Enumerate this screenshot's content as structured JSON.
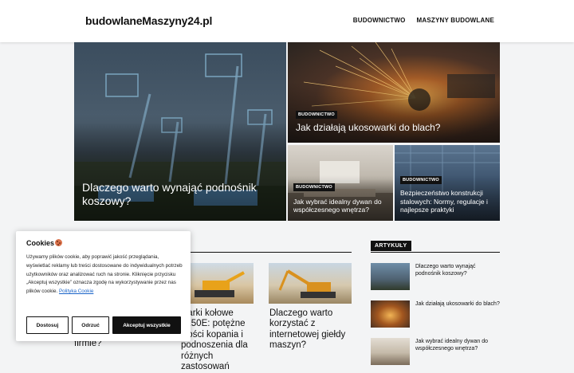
{
  "header": {
    "logo": "budowlaneMaszyny24.pl",
    "nav": [
      "BUDOWNICTWO",
      "MASZYNY BUDOWLANE"
    ]
  },
  "featured": [
    {
      "title": "Dlaczego warto wynająć podnośnik koszowy?",
      "tag": ""
    },
    {
      "title": "Jak działają ukosowarki do blach?",
      "tag": "BUDOWNICTWO"
    },
    {
      "title": "Jak wybrać idealny dywan do współczesnego wnętrza?",
      "tag": "BUDOWNICTWO"
    },
    {
      "title": "Bezpieczeństwo konstrukcji stalowych: Normy, regulacje i najlepsze praktyki",
      "tag": "BUDOWNICTWO"
    }
  ],
  "cards": [
    {
      "title": "firmie?"
    },
    {
      "title": "warki kołowe L150E: potężne wości kopania i podnoszenia dla różnych zastosowań"
    },
    {
      "title": "Dlaczego warto korzystać z internetowej giełdy maszyn?"
    }
  ],
  "sidebar": {
    "heading": "ARTYKUŁY",
    "items": [
      {
        "title": "Dlaczego warto wynająć podnośnik koszowy?"
      },
      {
        "title": "Jak działają ukosowarki do blach?"
      },
      {
        "title": "Jak wybrać idealny dywan do współczesnego wnętrza?"
      }
    ]
  },
  "cookie": {
    "title": "Cookies",
    "text": "Używamy plików cookie, aby poprawić jakość przeglądania, wyświetlać reklamy lub treści dostosowane do indywidualnych potrzeb użytkowników oraz analizować ruch na stronie. Kliknięcie przycisku „Akceptuj wszystkie” oznacza zgodę na wykorzystywanie przez nas plików cookie.",
    "policy_link": "Polityka Cookie",
    "buttons": {
      "customize": "Dostosuj",
      "reject": "Odrzuć",
      "accept": "Akceptuj wszystkie"
    }
  },
  "colors": {
    "accent": "#111111",
    "link": "#1a64c8",
    "background": "#f3f4f5"
  }
}
